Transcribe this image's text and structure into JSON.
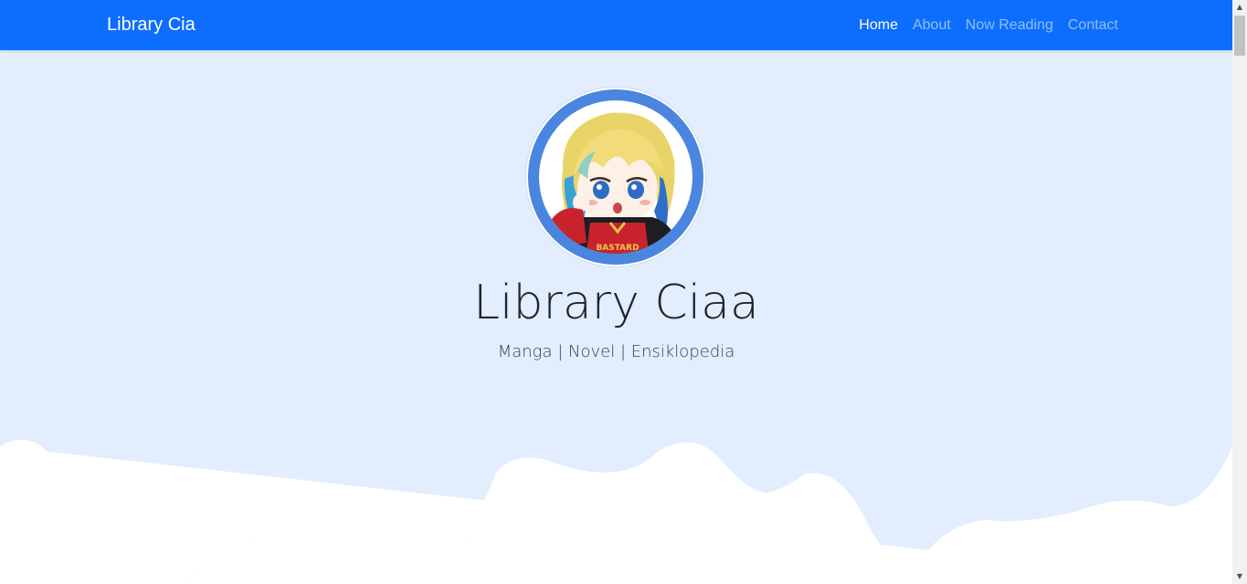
{
  "navbar": {
    "brand": "Library Cia",
    "links": [
      {
        "label": "Home",
        "active": true
      },
      {
        "label": "About",
        "active": false
      },
      {
        "label": "Now Reading",
        "active": false
      },
      {
        "label": "Contact",
        "active": false
      }
    ]
  },
  "hero": {
    "title": "Library Ciaa",
    "subtitle": "Manga | Novel | Ensiklopedia",
    "avatar": {
      "description_icon": "profile-avatar",
      "shirt_text": "BASTARD"
    }
  },
  "colors": {
    "navbar": "#0d6efd",
    "hero_background": "#e2edfe",
    "wave": "#ffffff",
    "avatar_ring": "#4a86e0"
  },
  "scrollbar": {
    "up_icon": "triangle-up-icon",
    "down_icon": "triangle-down-icon"
  }
}
